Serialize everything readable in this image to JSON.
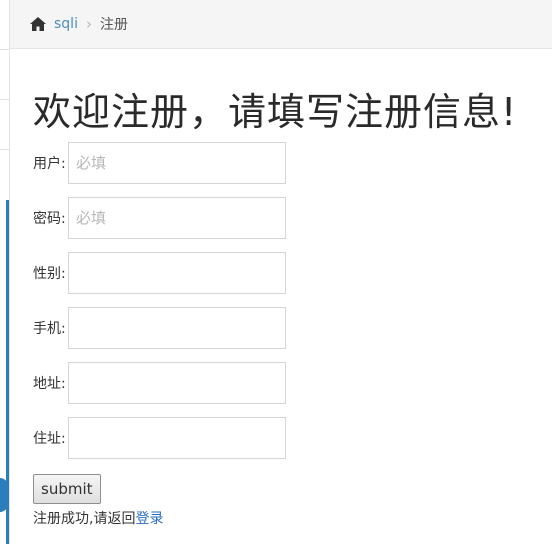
{
  "breadcrumb": {
    "home_icon": "home-icon",
    "home_label": "sqli",
    "separator": "›",
    "current": "注册"
  },
  "page": {
    "heading": "欢迎注册，请填写注册信息!"
  },
  "form": {
    "fields": [
      {
        "label": "用户:",
        "placeholder": "必填",
        "value": ""
      },
      {
        "label": "密码:",
        "placeholder": "必填",
        "value": ""
      },
      {
        "label": "性别:",
        "placeholder": "",
        "value": ""
      },
      {
        "label": "手机:",
        "placeholder": "",
        "value": ""
      },
      {
        "label": "地址:",
        "placeholder": "",
        "value": ""
      },
      {
        "label": "住址:",
        "placeholder": "",
        "value": ""
      }
    ],
    "submit_label": "submit"
  },
  "status": {
    "message": "注册成功,请返回",
    "link_label": "登录"
  },
  "colors": {
    "link": "#4c8fbd",
    "accent": "#2b7dbc",
    "breadcrumb_bg": "#f5f5f5"
  }
}
